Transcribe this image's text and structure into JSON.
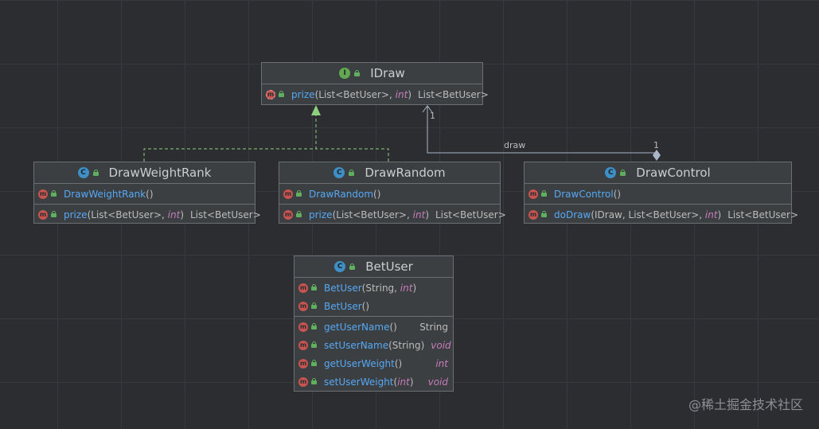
{
  "nodes": {
    "idraw": {
      "name": "IDraw",
      "kind": "I",
      "members": [
        {
          "name": "prize",
          "params": "(List<BetUser>, ",
          "kw": "int",
          "close": ")",
          "ret": "List<BetUser>",
          "ret_kw": false,
          "abstract": true
        }
      ]
    },
    "drawweightrank": {
      "name": "DrawWeightRank",
      "kind": "C",
      "constructor": {
        "name": "DrawWeightRank",
        "params": "()"
      },
      "methods": [
        {
          "name": "prize",
          "params": "(List<BetUser>, ",
          "kw": "int",
          "close": ")",
          "ret": "List<BetUser>"
        }
      ]
    },
    "drawrandom": {
      "name": "DrawRandom",
      "kind": "C",
      "constructor": {
        "name": "DrawRandom",
        "params": "()"
      },
      "methods": [
        {
          "name": "prize",
          "params": "(List<BetUser>, ",
          "kw": "int",
          "close": ")",
          "ret": "List<BetUser>"
        }
      ]
    },
    "drawcontrol": {
      "name": "DrawControl",
      "kind": "C",
      "constructor": {
        "name": "DrawControl",
        "params": "()"
      },
      "methods": [
        {
          "name": "doDraw",
          "params": "(IDraw, List<BetUser>, ",
          "kw": "int",
          "close": ")",
          "ret": "List<BetUser>"
        }
      ]
    },
    "betuser": {
      "name": "BetUser",
      "kind": "C",
      "constructors": [
        {
          "name": "BetUser",
          "params": "(String, ",
          "kw": "int",
          "close": ")"
        },
        {
          "name": "BetUser",
          "params": "()",
          "kw": "",
          "close": ""
        }
      ],
      "methods": [
        {
          "name": "getUserName",
          "params": "()",
          "kw": "",
          "close": "",
          "ret": "String",
          "ret_kw": false
        },
        {
          "name": "setUserName",
          "params": "(String)",
          "kw": "",
          "close": "",
          "ret": "void",
          "ret_kw": true
        },
        {
          "name": "getUserWeight",
          "params": "()",
          "kw": "",
          "close": "",
          "ret": "int",
          "ret_kw": true
        },
        {
          "name": "setUserWeight",
          "params": "(",
          "kw": "int",
          "close": ")",
          "ret": "void",
          "ret_kw": true
        }
      ]
    }
  },
  "icons": {
    "class_badge": "C",
    "interface_badge": "I",
    "method_badge": "m"
  },
  "edges": {
    "association_label": "draw",
    "multiplicity_source": "1",
    "multiplicity_target": "1"
  },
  "watermark": "@稀土掘金技术社区",
  "colors": {
    "background": "#2b2d30",
    "node_bg": "#3c3f41",
    "method_name": "#56a8f5",
    "keyword": "#c77dbb",
    "realization_arrow": "#8fd07d",
    "association_line": "#a9b7c6"
  }
}
